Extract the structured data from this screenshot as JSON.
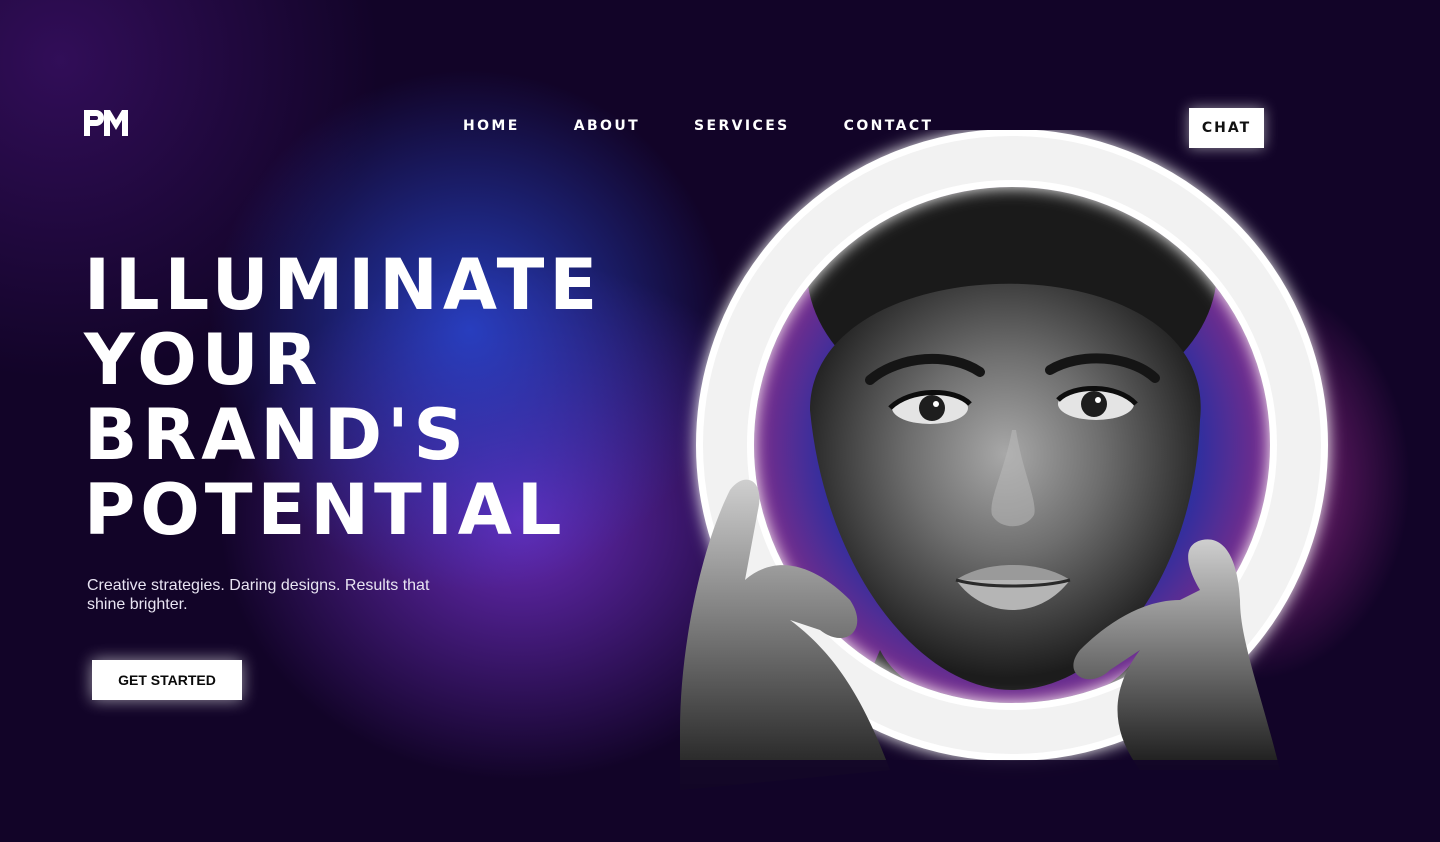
{
  "header": {
    "logo_text": "PM",
    "nav": [
      "HOME",
      "ABOUT",
      "SERVICES",
      "CONTACT"
    ],
    "chat_label": "CHAT"
  },
  "hero": {
    "headline_lines": [
      "ILLUMINATE",
      "YOUR",
      "BRAND'S",
      "POTENTIAL"
    ],
    "subtitle": "Creative strategies. Daring designs. Results that shine brighter.",
    "cta_label": "GET STARTED",
    "image_subject": "woman-with-ring-light"
  },
  "colors": {
    "background": "#120428",
    "accent_blue": "#2846d2",
    "accent_purple": "#7832d2",
    "accent_pink": "#be32aa",
    "button_bg": "#ffffff"
  }
}
